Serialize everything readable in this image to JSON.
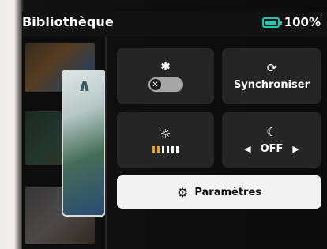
{
  "header": {
    "title": "Bibliothèque",
    "battery_percent": "100%",
    "battery_level": 1.0
  },
  "quick_settings": {
    "bluetooth": {
      "icon": "bluetooth-icon",
      "enabled": false
    },
    "sync": {
      "icon": "sync-icon",
      "label": "Synchroniser"
    },
    "brightness": {
      "icon": "brightness-icon",
      "level": 2,
      "max": 6
    },
    "night_mode": {
      "icon": "moon-icon",
      "value": "OFF"
    },
    "settings_button": {
      "icon": "gear-icon",
      "label": "Paramètres"
    }
  },
  "colors": {
    "accent": "#20c8b0",
    "brightness_on": "#f4a11a",
    "tile_bg": "#252525"
  }
}
